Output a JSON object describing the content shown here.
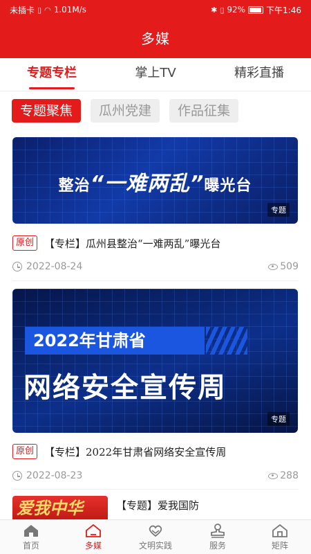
{
  "status_bar": {
    "carrier": "未插卡",
    "network_speed": "1.01M/s",
    "battery": "92%",
    "time": "下午1:46"
  },
  "app": {
    "title": "多媒"
  },
  "tabs": [
    {
      "label": "专题专栏",
      "active": true
    },
    {
      "label": "掌上TV",
      "active": false
    },
    {
      "label": "精彩直播",
      "active": false
    }
  ],
  "chips": [
    {
      "label": "专题聚焦",
      "active": true
    },
    {
      "label": "瓜州党建",
      "active": false
    },
    {
      "label": "作品征集",
      "active": false
    }
  ],
  "articles": [
    {
      "image_text_1": "整治",
      "image_text_2": "“一难两乱”",
      "image_text_3": "曝光台",
      "image_tag": "专题",
      "badge": "原创",
      "title": "【专栏】瓜州县整治“一难两乱”曝光台",
      "date": "2022-08-24",
      "views": "509"
    },
    {
      "image_band": "2022年甘肃省",
      "image_big": "网络安全宣传周",
      "image_tag": "专题",
      "badge": "原创",
      "title": "【专栏】2022年甘肃省网络安全宣传周",
      "date": "2022-08-23",
      "views": "288"
    },
    {
      "thumb_text": "爱我中华",
      "title": "【专题】爱我国防"
    }
  ],
  "bottom_nav": [
    {
      "label": "首页",
      "icon": "home-icon",
      "active": false
    },
    {
      "label": "多媒",
      "icon": "media-home-icon",
      "active": true
    },
    {
      "label": "文明实践",
      "icon": "heart-hands-icon",
      "active": false
    },
    {
      "label": "服务",
      "icon": "service-stamp-icon",
      "active": false
    },
    {
      "label": "矩阵",
      "icon": "matrix-house-icon",
      "active": false
    }
  ],
  "colors": {
    "brand": "#e31b1b"
  }
}
